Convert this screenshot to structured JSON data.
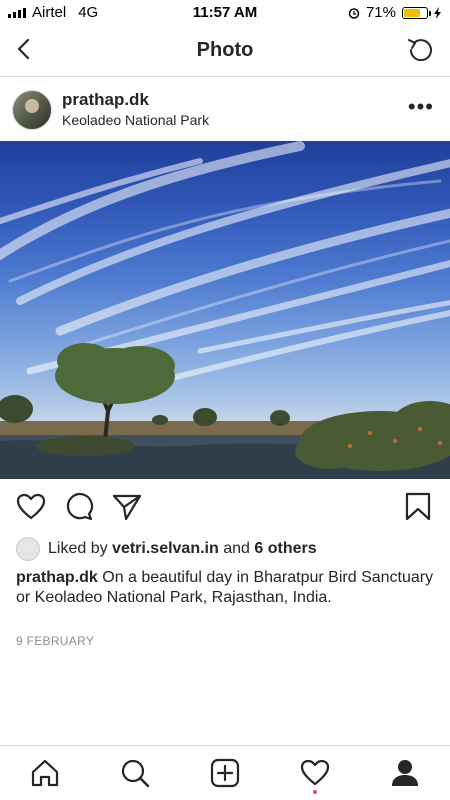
{
  "status": {
    "carrier": "Airtel",
    "network": "4G",
    "time": "11:57 AM",
    "battery": "71%",
    "battery_level": 0.71
  },
  "nav": {
    "title": "Photo"
  },
  "post": {
    "username": "prathap.dk",
    "location": "Keoladeo National Park",
    "liked_prefix": "Liked by",
    "liked_user": "vetri.selvan.in",
    "liked_suffix_and": "and",
    "liked_others": "6 others",
    "caption_user": "prathap.dk",
    "caption_text": "On a beautiful day in Bharatpur Bird Sanctuary or Keoladeo National Park, Rajasthan, India.",
    "date": "9 FEBRUARY"
  },
  "icons": {
    "back": "chevron-left-icon",
    "refresh": "refresh-icon",
    "more": "more-dots-icon",
    "like": "heart-icon",
    "comment": "comment-icon",
    "share": "send-icon",
    "save": "bookmark-icon",
    "home": "home-icon",
    "search": "search-icon",
    "add": "add-post-icon",
    "activity": "activity-heart-icon",
    "profile": "profile-icon"
  },
  "colors": {
    "accent_dot": "#ed4956",
    "battery": "#f0c000",
    "muted": "#8e8e8e"
  }
}
